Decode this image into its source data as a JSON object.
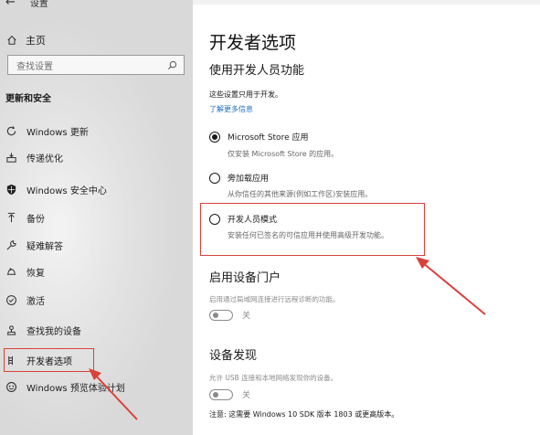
{
  "sidebar": {
    "back_label": "设置",
    "home_label": "主页",
    "search_placeholder": "查找设置",
    "section_title": "更新和安全",
    "items": [
      {
        "label": "Windows 更新",
        "icon": "sync-icon"
      },
      {
        "label": "传递优化",
        "icon": "delivery-icon"
      },
      {
        "label": "Windows 安全中心",
        "icon": "shield-icon"
      },
      {
        "label": "备份",
        "icon": "backup-icon"
      },
      {
        "label": "疑难解答",
        "icon": "wrench-icon"
      },
      {
        "label": "恢复",
        "icon": "recovery-icon"
      },
      {
        "label": "激活",
        "icon": "check-circle-icon"
      },
      {
        "label": "查找我的设备",
        "icon": "find-device-icon"
      },
      {
        "label": "开发者选项",
        "icon": "developer-icon"
      },
      {
        "label": "Windows 预览体验计划",
        "icon": "smiley-icon"
      }
    ]
  },
  "main": {
    "title": "开发者选项",
    "subtitle": "使用开发人员功能",
    "description": "这些设置只用于开发。",
    "learn_more": "了解更多信息",
    "options": [
      {
        "label": "Microsoft Store 应用",
        "desc": "仅安装 Microsoft Store 的应用。",
        "selected": true
      },
      {
        "label": "旁加载应用",
        "desc": "从你信任的其他来源(例如工作区)安装应用。",
        "selected": false
      },
      {
        "label": "开发人员模式",
        "desc": "安装任何已签名的可信应用并使用高级开发功能。",
        "selected": false
      }
    ],
    "portal": {
      "title": "启用设备门户",
      "desc": "启用通过局域网连接进行远程诊断的功能。",
      "toggle_label": "关"
    },
    "discovery": {
      "title": "设备发现",
      "desc": "允许 USB 连接和本地网络发现你的设备。",
      "toggle_label": "关"
    },
    "note": "注意: 这需要 Windows 10 SDK 版本 1803 或更高版本。"
  },
  "colors": {
    "highlight": "#d9413b",
    "link": "#1f6fc5"
  }
}
